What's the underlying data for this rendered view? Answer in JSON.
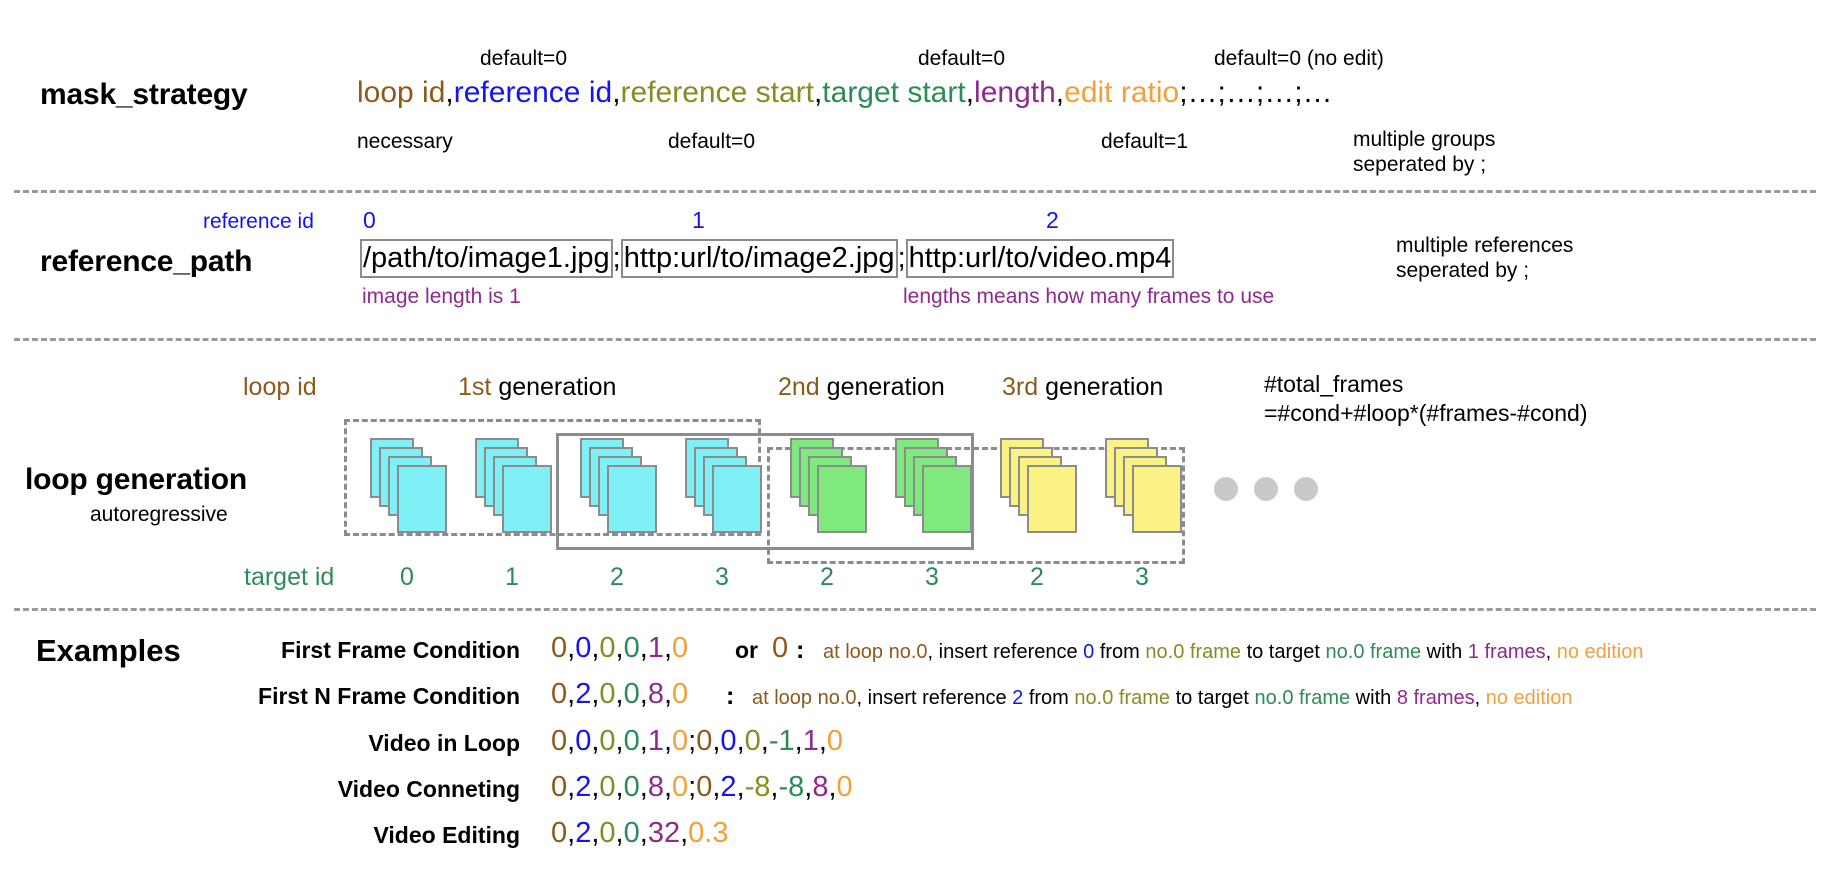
{
  "colors": {
    "brown": "#8c5a1b",
    "blue": "#1414f0",
    "olive": "#8a8a24",
    "green": "#2e8b57",
    "purple": "#8e2a8e",
    "orange": "#f0a03c",
    "gray": "#9a9a9a",
    "cyan_frame": "#7ff0f5",
    "green_frame": "#7fe87f",
    "yellow_frame": "#fbf285"
  },
  "mask_strategy": {
    "label": "mask_strategy",
    "fields": [
      {
        "text": "loop id",
        "color": "brown",
        "note_below": "necessary",
        "note_above": ""
      },
      {
        "text": "reference id",
        "color": "blue",
        "note_below": "default=0",
        "note_above": "default=0"
      },
      {
        "text": "reference start",
        "color": "olive",
        "note_below": "default=0",
        "note_above": ""
      },
      {
        "text": "target start",
        "color": "green",
        "note_below": "",
        "note_above": "default=0"
      },
      {
        "text": "length",
        "color": "purple",
        "note_below": "default=1",
        "note_above": ""
      },
      {
        "text": "edit ratio",
        "color": "orange",
        "note_below": "",
        "note_above": "default=0 (no edit)"
      }
    ],
    "separators": ",",
    "tail": ";…;…;…;…",
    "note_above_1": "default=0",
    "note_above_2": "default=0",
    "note_above_3": "default=0 (no edit)",
    "note_below_1": "necessary",
    "note_below_2": "default=0",
    "note_below_3": "default=1",
    "multiple_groups": "multiple groups\nseperated by ;"
  },
  "reference_path": {
    "label": "reference_path",
    "reference_id_label": "reference id",
    "ids": [
      "0",
      "1",
      "2"
    ],
    "paths": [
      "/path/to/image1.jpg",
      "http:url/to/image2.jpg",
      "http:url/to/video.mp4"
    ],
    "separator": ";",
    "note_left": "image length is 1",
    "note_right": "lengths means how many frames to use",
    "side_note": "multiple references\nseperated by ;"
  },
  "loop_generation": {
    "label": "loop generation",
    "sublabel": "autoregressive",
    "loop_id_label": "loop id",
    "target_id_label": "target id",
    "generations": [
      "1st",
      "2nd",
      "3rd"
    ],
    "generation_suffix": "generation",
    "total_frames_line1": "#total_frames",
    "total_frames_line2": "=#cond+#loop*(#frames-#cond)",
    "stacks": [
      {
        "color": "cyan",
        "target_id": "0"
      },
      {
        "color": "cyan",
        "target_id": "1"
      },
      {
        "color": "cyan",
        "target_id": "2"
      },
      {
        "color": "cyan",
        "target_id": "3"
      },
      {
        "color": "green",
        "target_id": "2"
      },
      {
        "color": "green",
        "target_id": "3"
      },
      {
        "color": "yellow",
        "target_id": "2"
      },
      {
        "color": "yellow",
        "target_id": "3"
      }
    ],
    "ellipsis_dots": 3
  },
  "examples": {
    "title": "Examples",
    "rows": [
      {
        "name": "First Frame Condition",
        "code": [
          {
            "t": "0",
            "c": "brown"
          },
          {
            "t": ",",
            "c": "black"
          },
          {
            "t": "0",
            "c": "blue"
          },
          {
            "t": ",",
            "c": "black"
          },
          {
            "t": "0",
            "c": "olive"
          },
          {
            "t": ",",
            "c": "black"
          },
          {
            "t": "0",
            "c": "green"
          },
          {
            "t": ",",
            "c": "black"
          },
          {
            "t": "1",
            "c": "purple"
          },
          {
            "t": ",",
            "c": "black"
          },
          {
            "t": "0",
            "c": "orange"
          }
        ],
        "or_text": "or",
        "alt_code": [
          {
            "t": "0",
            "c": "brown"
          }
        ],
        "colon": ":",
        "desc": [
          {
            "t": "at loop no.0",
            "c": "brown"
          },
          {
            "t": ", insert reference ",
            "c": "black"
          },
          {
            "t": "0",
            "c": "blue"
          },
          {
            "t": " from ",
            "c": "black"
          },
          {
            "t": "no.0 frame",
            "c": "olive"
          },
          {
            "t": " to target ",
            "c": "black"
          },
          {
            "t": "no.0 frame",
            "c": "green"
          },
          {
            "t": " with ",
            "c": "black"
          },
          {
            "t": "1 frames",
            "c": "purple"
          },
          {
            "t": ", ",
            "c": "black"
          },
          {
            "t": "no edition",
            "c": "orange"
          }
        ]
      },
      {
        "name": "First N Frame Condition",
        "code": [
          {
            "t": "0",
            "c": "brown"
          },
          {
            "t": ",",
            "c": "black"
          },
          {
            "t": "2",
            "c": "blue"
          },
          {
            "t": ",",
            "c": "black"
          },
          {
            "t": "0",
            "c": "olive"
          },
          {
            "t": ",",
            "c": "black"
          },
          {
            "t": "0",
            "c": "green"
          },
          {
            "t": ",",
            "c": "black"
          },
          {
            "t": "8",
            "c": "purple"
          },
          {
            "t": ",",
            "c": "black"
          },
          {
            "t": "0",
            "c": "orange"
          }
        ],
        "or_text": "",
        "alt_code": [],
        "colon": ":",
        "desc": [
          {
            "t": "at loop no.0",
            "c": "brown"
          },
          {
            "t": ", insert reference ",
            "c": "black"
          },
          {
            "t": "2",
            "c": "blue"
          },
          {
            "t": " from ",
            "c": "black"
          },
          {
            "t": "no.0 frame",
            "c": "olive"
          },
          {
            "t": " to target ",
            "c": "black"
          },
          {
            "t": "no.0 frame",
            "c": "green"
          },
          {
            "t": " with ",
            "c": "black"
          },
          {
            "t": "8 frames",
            "c": "purple"
          },
          {
            "t": ", ",
            "c": "black"
          },
          {
            "t": "no edition",
            "c": "orange"
          }
        ]
      },
      {
        "name": "Video in Loop",
        "code": [
          {
            "t": "0",
            "c": "brown"
          },
          {
            "t": ",",
            "c": "black"
          },
          {
            "t": "0",
            "c": "blue"
          },
          {
            "t": ",",
            "c": "black"
          },
          {
            "t": "0",
            "c": "olive"
          },
          {
            "t": ",",
            "c": "black"
          },
          {
            "t": "0",
            "c": "green"
          },
          {
            "t": ",",
            "c": "black"
          },
          {
            "t": "1",
            "c": "purple"
          },
          {
            "t": ",",
            "c": "black"
          },
          {
            "t": "0",
            "c": "orange"
          },
          {
            "t": ";",
            "c": "black"
          },
          {
            "t": "0",
            "c": "brown"
          },
          {
            "t": ",",
            "c": "black"
          },
          {
            "t": "0",
            "c": "blue"
          },
          {
            "t": ",",
            "c": "black"
          },
          {
            "t": "0",
            "c": "olive"
          },
          {
            "t": ",",
            "c": "black"
          },
          {
            "t": "-1",
            "c": "green"
          },
          {
            "t": ",",
            "c": "black"
          },
          {
            "t": "1",
            "c": "purple"
          },
          {
            "t": ",",
            "c": "black"
          },
          {
            "t": "0",
            "c": "orange"
          }
        ],
        "or_text": "",
        "alt_code": [],
        "colon": "",
        "desc": []
      },
      {
        "name": "Video Conneting",
        "code": [
          {
            "t": "0",
            "c": "brown"
          },
          {
            "t": ",",
            "c": "black"
          },
          {
            "t": "2",
            "c": "blue"
          },
          {
            "t": ",",
            "c": "black"
          },
          {
            "t": "0",
            "c": "olive"
          },
          {
            "t": ",",
            "c": "black"
          },
          {
            "t": "0",
            "c": "green"
          },
          {
            "t": ",",
            "c": "black"
          },
          {
            "t": "8",
            "c": "purple"
          },
          {
            "t": ",",
            "c": "black"
          },
          {
            "t": "0",
            "c": "orange"
          },
          {
            "t": ";",
            "c": "black"
          },
          {
            "t": "0",
            "c": "brown"
          },
          {
            "t": ",",
            "c": "black"
          },
          {
            "t": "2",
            "c": "blue"
          },
          {
            "t": ",",
            "c": "black"
          },
          {
            "t": "-8",
            "c": "olive"
          },
          {
            "t": ",",
            "c": "black"
          },
          {
            "t": "-8",
            "c": "green"
          },
          {
            "t": ",",
            "c": "black"
          },
          {
            "t": "8",
            "c": "purple"
          },
          {
            "t": ",",
            "c": "black"
          },
          {
            "t": "0",
            "c": "orange"
          }
        ],
        "or_text": "",
        "alt_code": [],
        "colon": "",
        "desc": []
      },
      {
        "name": "Video Editing",
        "code": [
          {
            "t": "0",
            "c": "brown"
          },
          {
            "t": ",",
            "c": "black"
          },
          {
            "t": "2",
            "c": "blue"
          },
          {
            "t": ",",
            "c": "black"
          },
          {
            "t": "0",
            "c": "olive"
          },
          {
            "t": ",",
            "c": "black"
          },
          {
            "t": "0",
            "c": "green"
          },
          {
            "t": ",",
            "c": "black"
          },
          {
            "t": "32",
            "c": "purple"
          },
          {
            "t": ",",
            "c": "black"
          },
          {
            "t": "0.3",
            "c": "orange"
          }
        ],
        "or_text": "",
        "alt_code": [],
        "colon": "",
        "desc": []
      }
    ]
  }
}
